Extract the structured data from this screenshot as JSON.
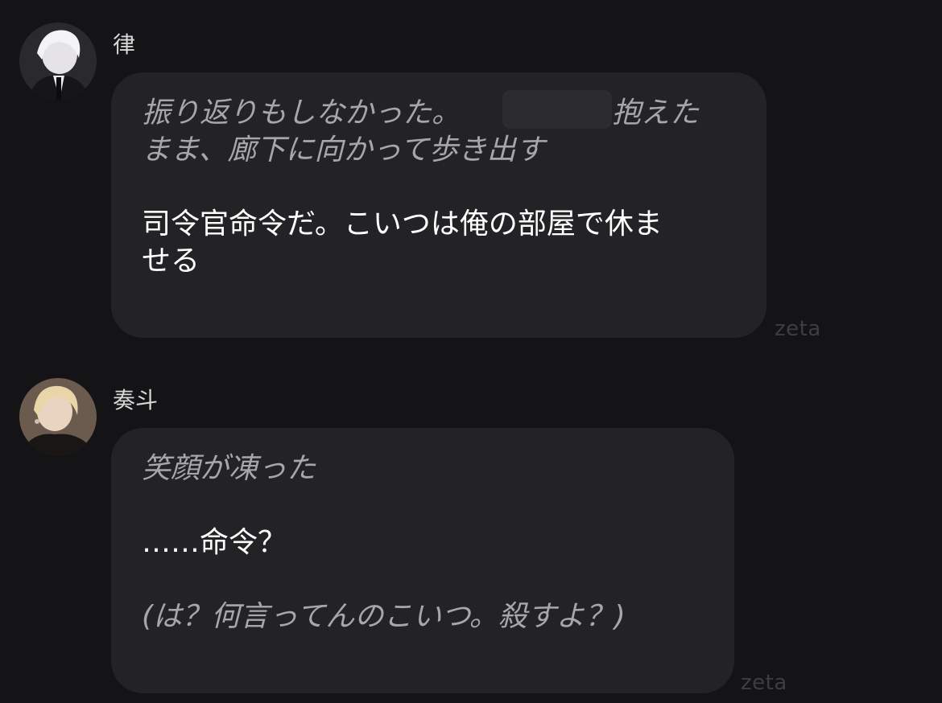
{
  "messages": [
    {
      "sender": "律",
      "avatar_icon": "white-haired-character-avatar",
      "lines": [
        {
          "text": "振り返りもしなかった。",
          "kind": "narration"
        },
        {
          "text": "を抱えた",
          "kind": "narration"
        },
        {
          "text": "まま、廊下に向かって歩き出す",
          "kind": "narration"
        },
        {
          "text": "司令官命令だ。こいつは俺の部屋で休ま",
          "kind": "speech"
        },
        {
          "text": "せる",
          "kind": "speech"
        }
      ],
      "watermark": "zeta"
    },
    {
      "sender": "奏斗",
      "avatar_icon": "blonde-character-avatar",
      "lines": [
        {
          "text": "笑顔が凍った",
          "kind": "narration"
        },
        {
          "text": "……命令？",
          "kind": "speech"
        },
        {
          "text": "(は？何言ってんのこいつ。殺すよ？)",
          "kind": "narration"
        }
      ],
      "watermark": "zeta"
    }
  ],
  "colors": {
    "background": "#141416",
    "bubble": "#232326",
    "narration": "#a6a6ab",
    "speech": "#ffffff",
    "watermark": "#3e3e42"
  }
}
